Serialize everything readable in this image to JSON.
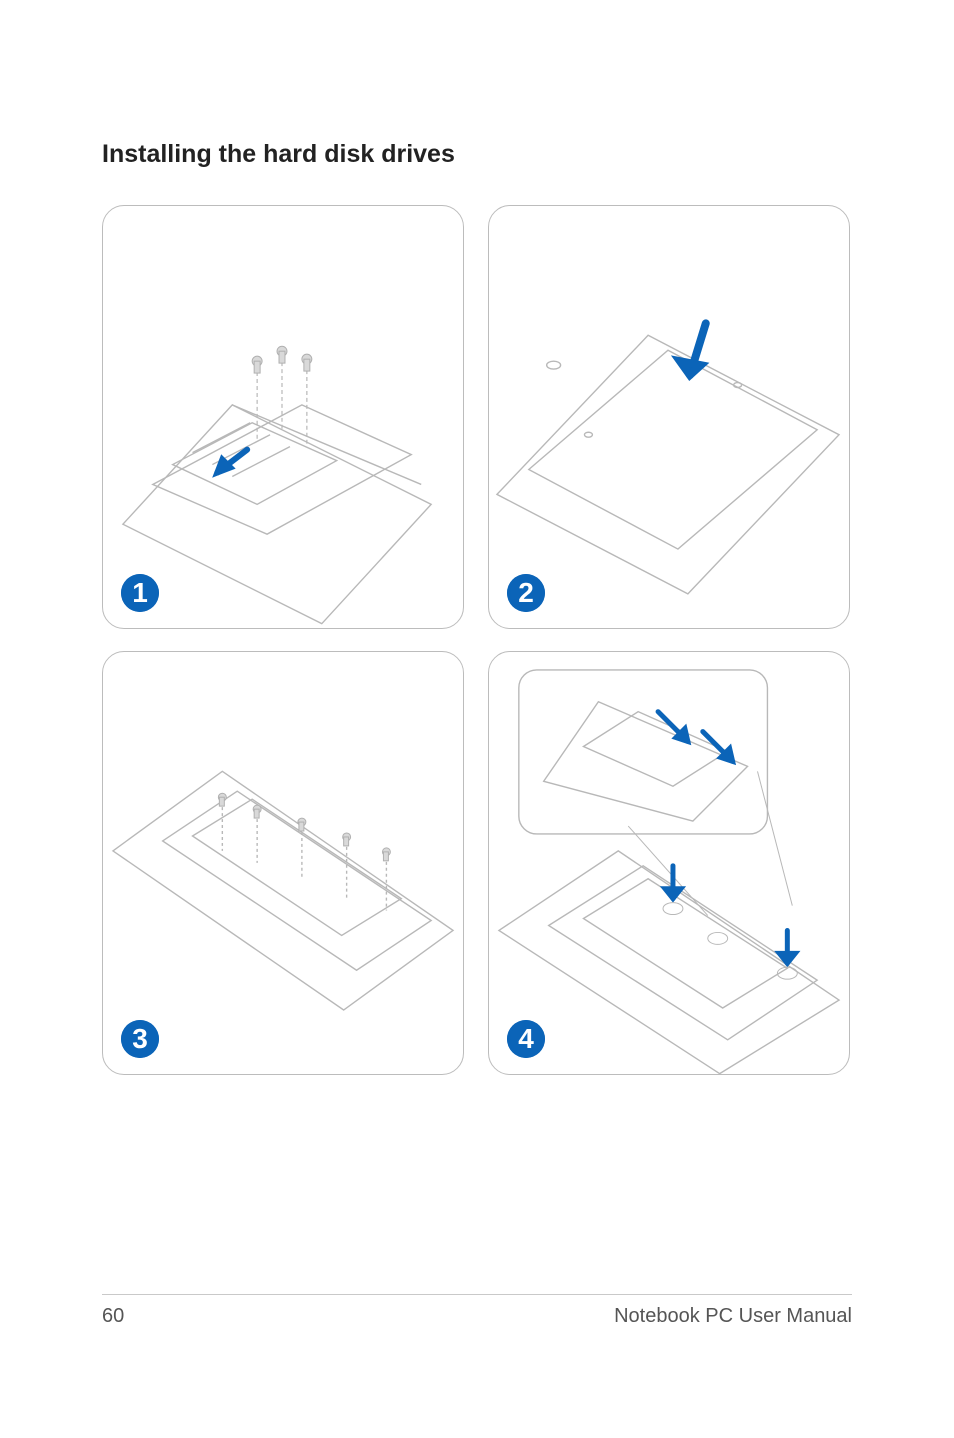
{
  "page": {
    "section_title": "Installing the hard disk drives",
    "page_number": "60",
    "footer_label": "Notebook PC User Manual"
  },
  "steps": [
    {
      "id": 1,
      "label": "1",
      "alt": "Step 1: insert HDD bracket and secure screws on bottom compartment"
    },
    {
      "id": 2,
      "label": "2",
      "alt": "Step 2: replace bottom cover panel and press down"
    },
    {
      "id": 3,
      "label": "3",
      "alt": "Step 3: turn over unit, install and screw drive bay on top side"
    },
    {
      "id": 4,
      "label": "4",
      "alt": "Step 4: slide drive into connector (inset shows SATA connection detail)"
    }
  ],
  "colors": {
    "accent": "#0b64b8",
    "panel_border": "#bcbcbc"
  }
}
